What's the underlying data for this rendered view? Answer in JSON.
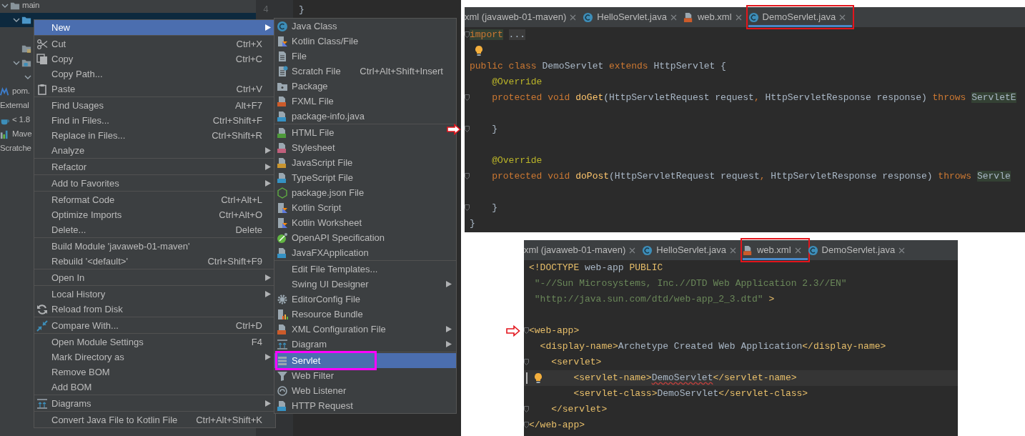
{
  "project_tree": {
    "items": [
      {
        "label": "main",
        "kind": "folder",
        "expanded": true,
        "selected": false,
        "children": [
          {
            "kind": "folder-source",
            "expanded": true,
            "selected": true
          },
          {
            "kind": "folder-resources",
            "selected": false
          },
          {
            "kind": "folder-module",
            "expanded": true,
            "selected": false,
            "children": [
              {
                "expanded": true,
                "selected": false
              }
            ]
          }
        ]
      },
      {
        "label": "pom.",
        "kind": "maven",
        "selected": false
      },
      {
        "label": "External",
        "selected": false
      },
      {
        "label": "< 1.8",
        "kind": "jdk",
        "selected": false
      },
      {
        "label": "Mave",
        "kind": "maven-bars",
        "selected": false
      },
      {
        "label": "Scratche",
        "selected": false
      }
    ]
  },
  "background_editor": {
    "line_number": "4",
    "code": "}"
  },
  "context_menu": {
    "groups": [
      {
        "items": [
          {
            "label": "New",
            "submenu": true,
            "selected": true
          }
        ]
      },
      {
        "items": [
          {
            "label": "Cut",
            "kind": "scissors",
            "shortcut": "Ctrl+X",
            "submenu": false,
            "selected": false
          },
          {
            "label": "Copy",
            "kind": "copy",
            "shortcut": "Ctrl+C",
            "submenu": false,
            "selected": false
          },
          {
            "label": "Copy Path...",
            "submenu": false,
            "selected": false
          },
          {
            "label": "Paste",
            "kind": "clipboard",
            "shortcut": "Ctrl+V",
            "submenu": false,
            "selected": false
          }
        ]
      },
      {
        "items": [
          {
            "label": "Find Usages",
            "shortcut": "Alt+F7",
            "submenu": false,
            "selected": false
          },
          {
            "label": "Find in Files...",
            "shortcut": "Ctrl+Shift+F",
            "submenu": false,
            "selected": false
          },
          {
            "label": "Replace in Files...",
            "shortcut": "Ctrl+Shift+R",
            "submenu": false,
            "selected": false
          },
          {
            "label": "Analyze",
            "submenu": true,
            "selected": false
          }
        ]
      },
      {
        "items": [
          {
            "label": "Refactor",
            "submenu": true,
            "selected": false
          }
        ]
      },
      {
        "items": [
          {
            "label": "Add to Favorites",
            "submenu": true,
            "selected": false
          }
        ]
      },
      {
        "items": [
          {
            "label": "Reformat Code",
            "shortcut": "Ctrl+Alt+L",
            "submenu": false,
            "selected": false
          },
          {
            "label": "Optimize Imports",
            "shortcut": "Ctrl+Alt+O",
            "submenu": false,
            "selected": false
          },
          {
            "label": "Delete...",
            "shortcut": "Delete",
            "submenu": false,
            "selected": false
          }
        ]
      },
      {
        "items": [
          {
            "label": "Build Module 'javaweb-01-maven'",
            "submenu": false,
            "selected": false
          },
          {
            "label": "Rebuild '<default>'",
            "shortcut": "Ctrl+Shift+F9",
            "submenu": false,
            "selected": false
          }
        ]
      },
      {
        "items": [
          {
            "label": "Open In",
            "submenu": true,
            "selected": false
          }
        ]
      },
      {
        "items": [
          {
            "label": "Local History",
            "submenu": true,
            "selected": false
          },
          {
            "label": "Reload from Disk",
            "kind": "reload",
            "submenu": false,
            "selected": false
          }
        ]
      },
      {
        "items": [
          {
            "label": "Compare With...",
            "kind": "compare",
            "shortcut": "Ctrl+D",
            "submenu": false,
            "selected": false
          }
        ]
      },
      {
        "items": [
          {
            "label": "Open Module Settings",
            "shortcut": "F4",
            "submenu": false,
            "selected": false
          },
          {
            "label": "Mark Directory as",
            "submenu": true,
            "selected": false
          },
          {
            "label": "Remove BOM",
            "submenu": false,
            "selected": false
          },
          {
            "label": "Add BOM",
            "submenu": false,
            "selected": false
          }
        ]
      },
      {
        "items": [
          {
            "label": "Diagrams",
            "kind": "diagram",
            "submenu": true,
            "selected": false
          }
        ]
      },
      {
        "items": [
          {
            "label": "Convert Java File to Kotlin File",
            "shortcut": "Ctrl+Alt+Shift+K",
            "submenu": false,
            "selected": false
          }
        ]
      }
    ]
  },
  "new_submenu": {
    "groups": [
      {
        "items": [
          {
            "label": "Java Class",
            "kind": "class",
            "submenu": false,
            "selected": false,
            "annotated": false
          },
          {
            "label": "Kotlin Class/File",
            "kind": "kotlin",
            "submenu": false,
            "selected": false,
            "annotated": false
          },
          {
            "label": "File",
            "kind": "file",
            "submenu": false,
            "selected": false,
            "annotated": false
          },
          {
            "label": "Scratch File",
            "kind": "scratch",
            "shortcut": "Ctrl+Alt+Shift+Insert",
            "submenu": false,
            "selected": false,
            "annotated": false
          },
          {
            "label": "Package",
            "kind": "package",
            "submenu": false,
            "selected": false,
            "annotated": false
          },
          {
            "label": "FXML File",
            "kind": "fxml",
            "submenu": false,
            "selected": false,
            "annotated": false
          },
          {
            "label": "package-info.java",
            "kind": "java-file",
            "submenu": false,
            "selected": false,
            "annotated": false
          }
        ]
      },
      {
        "items": [
          {
            "label": "HTML File",
            "kind": "html",
            "submenu": false,
            "selected": false,
            "annotated": false
          },
          {
            "label": "Stylesheet",
            "kind": "css",
            "submenu": false,
            "selected": false,
            "annotated": false
          },
          {
            "label": "JavaScript File",
            "kind": "js",
            "submenu": false,
            "selected": false,
            "annotated": false
          },
          {
            "label": "TypeScript File",
            "kind": "ts",
            "submenu": false,
            "selected": false,
            "annotated": false
          },
          {
            "label": "package.json File",
            "kind": "node",
            "submenu": false,
            "selected": false,
            "annotated": false
          },
          {
            "label": "Kotlin Script",
            "kind": "kotlin",
            "submenu": false,
            "selected": false,
            "annotated": false
          },
          {
            "label": "Kotlin Worksheet",
            "kind": "kotlin",
            "submenu": false,
            "selected": false,
            "annotated": false
          },
          {
            "label": "OpenAPI Specification",
            "kind": "openapi",
            "submenu": false,
            "selected": false,
            "annotated": false
          },
          {
            "label": "JavaFXApplication",
            "kind": "java-file",
            "submenu": false,
            "selected": false,
            "annotated": false
          }
        ]
      },
      {
        "items": [
          {
            "label": "Edit File Templates...",
            "submenu": false,
            "selected": false,
            "annotated": false
          },
          {
            "label": "Swing UI Designer",
            "submenu": true,
            "selected": false,
            "annotated": false
          },
          {
            "label": "EditorConfig File",
            "kind": "gear",
            "submenu": false,
            "selected": false,
            "annotated": false
          },
          {
            "label": "Resource Bundle",
            "kind": "bundle",
            "submenu": false,
            "selected": false,
            "annotated": false
          },
          {
            "label": "XML Configuration File",
            "kind": "xml",
            "submenu": true,
            "selected": false,
            "annotated": false
          },
          {
            "label": "Diagram",
            "kind": "diagram",
            "submenu": true,
            "selected": false,
            "annotated": false
          }
        ]
      },
      {
        "items": [
          {
            "label": "Servlet",
            "kind": "servlet",
            "submenu": false,
            "selected": true,
            "annotated": true
          },
          {
            "label": "Web Filter",
            "kind": "filter",
            "submenu": false,
            "selected": false,
            "annotated": false
          },
          {
            "label": "Web Listener",
            "kind": "listener",
            "submenu": false,
            "selected": false,
            "annotated": false
          },
          {
            "label": "HTTP Request",
            "kind": "api",
            "submenu": false,
            "selected": false,
            "annotated": false
          }
        ]
      }
    ]
  },
  "editors": [
    {
      "tabs": [
        {
          "label": "xml (javaweb-01-maven)",
          "selected": false,
          "annotated": false
        },
        {
          "label": "HelloServlet.java",
          "kind": "class",
          "selected": false,
          "annotated": false
        },
        {
          "label": "web.xml",
          "kind": "xml",
          "selected": false,
          "annotated": false
        },
        {
          "label": "DemoServlet.java",
          "kind": "class",
          "selected": true,
          "annotated": true
        }
      ],
      "lines": [
        {
          "tokens": [
            {
              "kind": "kwbg",
              "text": "import"
            },
            {
              "kind": "folded",
              "text": "..."
            }
          ],
          "fold": true,
          "bulb": false,
          "current": false,
          "marked": false
        },
        {
          "fold": false,
          "bulb": true,
          "current": false,
          "marked": false
        },
        {
          "tokens": [
            {
              "kind": "kw",
              "text": "public class "
            },
            {
              "kind": "plain",
              "text": "DemoServlet "
            },
            {
              "kind": "kw",
              "text": "extends "
            },
            {
              "kind": "plain",
              "text": "HttpServlet {"
            }
          ],
          "fold": false,
          "bulb": false,
          "current": false,
          "marked": false
        },
        {
          "tokens": [
            {
              "kind": "ann",
              "text": "    @Override"
            }
          ],
          "fold": false,
          "bulb": false,
          "current": false,
          "marked": false
        },
        {
          "tokens": [
            {
              "kind": "kw",
              "text": "    protected void "
            },
            {
              "kind": "fn",
              "text": "doGet"
            },
            {
              "kind": "plain",
              "text": "(HttpServletRequest request"
            },
            {
              "kind": "kw",
              "text": ", "
            },
            {
              "kind": "plain",
              "text": "HttpServletResponse response) "
            },
            {
              "kind": "kw",
              "text": "throws "
            },
            {
              "kind": "typebg",
              "text": "ServletE"
            }
          ],
          "fold": true,
          "bulb": false,
          "current": false,
          "marked": false
        },
        {
          "fold": false,
          "bulb": false,
          "current": false,
          "marked": false
        },
        {
          "tokens": [
            {
              "kind": "plain",
              "text": "    }"
            }
          ],
          "fold": true,
          "bulb": false,
          "current": false,
          "marked": true
        },
        {
          "fold": false,
          "bulb": false,
          "current": false,
          "marked": false
        },
        {
          "tokens": [
            {
              "kind": "ann",
              "text": "    @Override"
            }
          ],
          "fold": false,
          "bulb": false,
          "current": false,
          "marked": false
        },
        {
          "tokens": [
            {
              "kind": "kw",
              "text": "    protected void "
            },
            {
              "kind": "fn",
              "text": "doPost"
            },
            {
              "kind": "plain",
              "text": "(HttpServletRequest request"
            },
            {
              "kind": "kw",
              "text": ", "
            },
            {
              "kind": "plain",
              "text": "HttpServletResponse response) "
            },
            {
              "kind": "kw",
              "text": "throws "
            },
            {
              "kind": "typebg",
              "text": "Servle"
            }
          ],
          "fold": true,
          "bulb": false,
          "current": false,
          "marked": false
        },
        {
          "fold": false,
          "bulb": false,
          "current": false,
          "marked": false
        },
        {
          "tokens": [
            {
              "kind": "plain",
              "text": "    }"
            }
          ],
          "fold": true,
          "bulb": false,
          "current": false,
          "marked": false
        },
        {
          "tokens": [
            {
              "kind": "plain",
              "text": "}"
            }
          ],
          "fold": false,
          "bulb": false,
          "current": false,
          "marked": false
        }
      ]
    },
    {
      "tabs": [
        {
          "label": "xml (javaweb-01-maven)",
          "selected": false,
          "annotated": false
        },
        {
          "label": "HelloServlet.java",
          "kind": "class",
          "selected": false,
          "annotated": false
        },
        {
          "label": "web.xml",
          "kind": "xml",
          "selected": true,
          "annotated": true
        },
        {
          "label": "DemoServlet.java",
          "kind": "class",
          "selected": false,
          "annotated": false
        }
      ],
      "lines": [
        {
          "tokens": [
            {
              "kind": "tag",
              "text": "<!DOCTYPE"
            },
            {
              "kind": "plain",
              "text": " web-app "
            },
            {
              "kind": "tag",
              "text": "PUBLIC"
            }
          ],
          "fold": false,
          "bulb": false,
          "current": false,
          "marked": false
        },
        {
          "tokens": [
            {
              "kind": "str",
              "text": " \"-//Sun Microsystems, Inc.//DTD Web Application 2.3//EN\""
            }
          ],
          "fold": false,
          "bulb": false,
          "current": false,
          "marked": false
        },
        {
          "tokens": [
            {
              "kind": "str",
              "text": " \"http://java.sun.com/dtd/web-app_2_3.dtd\""
            },
            {
              "kind": "tag",
              "text": " >"
            }
          ],
          "fold": false,
          "bulb": false,
          "current": false,
          "marked": false
        },
        {
          "fold": false,
          "bulb": false,
          "current": false,
          "marked": false
        },
        {
          "tokens": [
            {
              "kind": "tag",
              "text": "<web-app>"
            }
          ],
          "fold": true,
          "bulb": false,
          "current": false,
          "marked": true
        },
        {
          "tokens": [
            {
              "kind": "tag",
              "text": "  <display-name>"
            },
            {
              "kind": "plain",
              "text": "Archetype Created Web Application"
            },
            {
              "kind": "tag",
              "text": "</display-name>"
            }
          ],
          "fold": false,
          "bulb": false,
          "current": false,
          "marked": false
        },
        {
          "tokens": [
            {
              "kind": "tag",
              "text": "    <servlet>"
            }
          ],
          "fold": true,
          "bulb": false,
          "current": false,
          "marked": false
        },
        {
          "tokens": [
            {
              "kind": "tag",
              "text": "        <servlet-name>"
            },
            {
              "kind": "typo",
              "text": "DemoServlet"
            },
            {
              "kind": "tag",
              "text": "</servlet-name>"
            }
          ],
          "fold": false,
          "bulb": true,
          "current": true,
          "marked": false
        },
        {
          "tokens": [
            {
              "kind": "tag",
              "text": "        <servlet-class>"
            },
            {
              "kind": "plain",
              "text": "DemoServlet"
            },
            {
              "kind": "tag",
              "text": "</servlet-class>"
            }
          ],
          "fold": false,
          "bulb": false,
          "current": false,
          "marked": false
        },
        {
          "tokens": [
            {
              "kind": "tag",
              "text": "    </servlet>"
            }
          ],
          "fold": true,
          "bulb": false,
          "current": false,
          "marked": false
        },
        {
          "tokens": [
            {
              "kind": "tag",
              "text": "</web-app>"
            }
          ],
          "fold": true,
          "bulb": false,
          "current": false,
          "marked": false
        }
      ]
    }
  ]
}
